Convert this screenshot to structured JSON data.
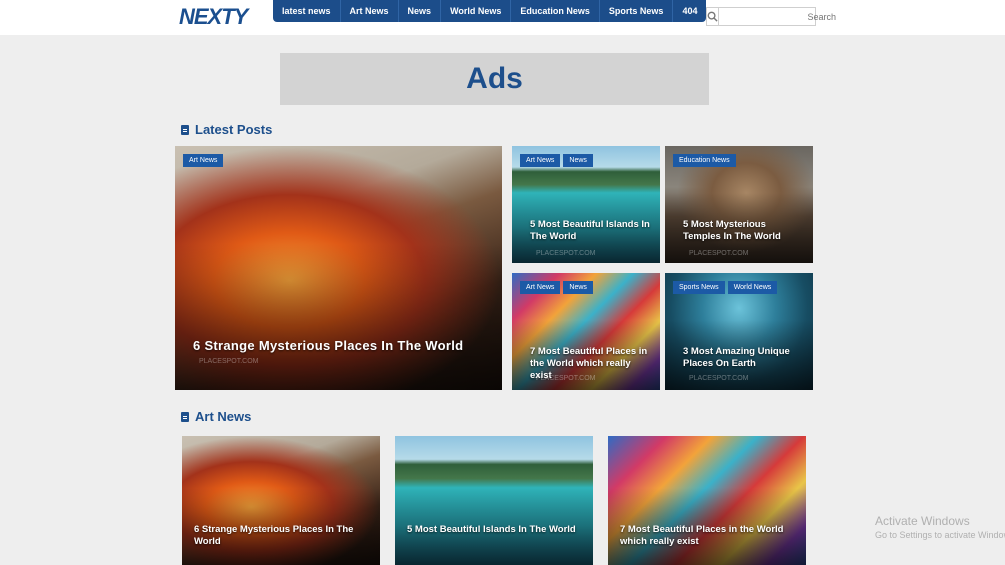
{
  "header": {
    "logo": "NEXTY",
    "nav": [
      "latest news",
      "Art News",
      "News",
      "World News",
      "Education News",
      "Sports News",
      "404"
    ],
    "search_placeholder": "Search"
  },
  "ads": {
    "label": "Ads"
  },
  "latest": {
    "heading": "Latest Posts",
    "featured": {
      "tags": [
        "Art News"
      ],
      "title": "6 Strange Mysterious Places In The World",
      "watermark": "PLACESPOT.COM"
    },
    "cards": [
      {
        "tags": [
          "Art News",
          "News"
        ],
        "title": "5 Most Beautiful Islands In The World",
        "watermark": "PLACESPOT.COM"
      },
      {
        "tags": [
          "Education News"
        ],
        "title": "5 Most Mysterious Temples In The World",
        "watermark": "PLACESPOT.COM"
      },
      {
        "tags": [
          "Art News",
          "News"
        ],
        "title": "7 Most Beautiful Places in the World which really exist",
        "watermark": "PLACESPOT.COM"
      },
      {
        "tags": [
          "Sports News",
          "World News"
        ],
        "title": "3 Most Amazing Unique Places On Earth",
        "watermark": "PLACESPOT.COM"
      }
    ]
  },
  "art": {
    "heading": "Art News",
    "cards": [
      {
        "title": "6 Strange Mysterious Places In The World"
      },
      {
        "title": "5 Most Beautiful Islands In The World"
      },
      {
        "title": "7 Most Beautiful Places in the World which really exist"
      }
    ]
  },
  "system": {
    "activate_title": "Activate Windows",
    "activate_sub": "Go to Settings to activate Windows."
  },
  "colors": {
    "brand": "#1c4d8a",
    "tag": "#1c5aa6",
    "background": "#eeeeee"
  }
}
